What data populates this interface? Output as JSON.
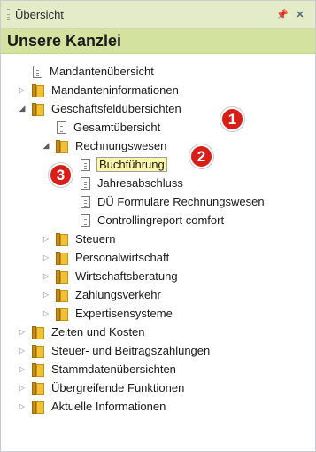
{
  "panel": {
    "title": "Übersicht",
    "pin_icon": "pin-icon",
    "close_icon": "close-icon",
    "heading": "Unsere Kanzlei"
  },
  "tree": {
    "items": [
      {
        "label": "Mandantenübersicht",
        "icon": "document-icon",
        "expander": "none"
      },
      {
        "label": "Mandanteninformationen",
        "icon": "folder-icon",
        "expander": "collapsed"
      },
      {
        "label": "Geschäftsfeldübersichten",
        "icon": "folder-icon",
        "expander": "expanded"
      },
      {
        "label": "Gesamtübersicht",
        "icon": "document-icon",
        "expander": "none"
      },
      {
        "label": "Rechnungswesen",
        "icon": "folder-icon",
        "expander": "expanded"
      },
      {
        "label": "Buchführung",
        "icon": "document-icon",
        "expander": "none",
        "selected": true
      },
      {
        "label": "Jahresabschluss",
        "icon": "document-icon",
        "expander": "none"
      },
      {
        "label": "DÜ Formulare Rechnungswesen",
        "icon": "document-icon",
        "expander": "none"
      },
      {
        "label": "Controllingreport comfort",
        "icon": "document-icon",
        "expander": "none"
      },
      {
        "label": "Steuern",
        "icon": "folder-icon",
        "expander": "collapsed"
      },
      {
        "label": "Personalwirtschaft",
        "icon": "folder-icon",
        "expander": "collapsed"
      },
      {
        "label": "Wirtschaftsberatung",
        "icon": "folder-icon",
        "expander": "collapsed"
      },
      {
        "label": "Zahlungsverkehr",
        "icon": "folder-icon",
        "expander": "collapsed"
      },
      {
        "label": "Expertisensysteme",
        "icon": "folder-icon",
        "expander": "collapsed"
      },
      {
        "label": "Zeiten und Kosten",
        "icon": "folder-icon",
        "expander": "collapsed"
      },
      {
        "label": "Steuer- und Beitragszahlungen",
        "icon": "folder-icon",
        "expander": "collapsed"
      },
      {
        "label": "Stammdatenübersichten",
        "icon": "folder-icon",
        "expander": "collapsed"
      },
      {
        "label": "Übergreifende Funktionen",
        "icon": "folder-icon",
        "expander": "collapsed"
      },
      {
        "label": "Aktuelle Informationen",
        "icon": "folder-icon",
        "expander": "collapsed"
      }
    ]
  },
  "callouts": [
    {
      "label": "1",
      "color": "#d91e18"
    },
    {
      "label": "2",
      "color": "#d91e18"
    },
    {
      "label": "3",
      "color": "#d91e18"
    }
  ],
  "colors": {
    "titlebar": "#e3ebc9",
    "heading_bar": "#d4e2a0",
    "selection": "#fff7a8",
    "folder": "#f2c033"
  }
}
